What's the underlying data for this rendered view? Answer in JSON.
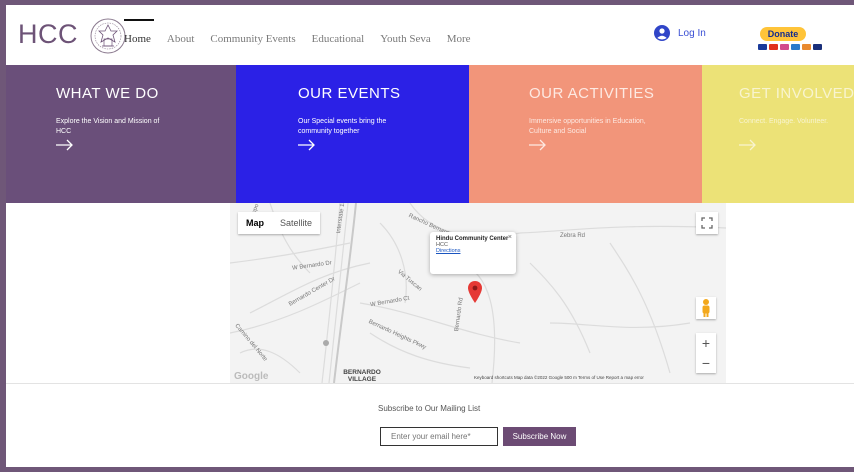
{
  "header": {
    "logo": "HCC",
    "nav": [
      "Home",
      "About",
      "Community Events",
      "Educational",
      "Youth Seva",
      "More"
    ],
    "login": "Log In",
    "donate": "Donate"
  },
  "panels": [
    {
      "title": "WHAT WE DO",
      "desc": "Explore the Vision and Mission of HCC",
      "color": "#6a4f7a"
    },
    {
      "title": "OUR EVENTS",
      "desc": "Our Special events bring the community together",
      "color": "#2b21e6"
    },
    {
      "title": "OUR ACTIVITIES",
      "desc": "Immersive opportunities in Education, Culture and Social",
      "color": "#f2957a"
    },
    {
      "title": "GET INVOLVED",
      "desc": "Connect. Engage. Volunteer.",
      "color": "#ece277"
    }
  ],
  "map": {
    "type_map": "Map",
    "type_satellite": "Satellite",
    "popup_name": "Hindu Community Center",
    "popup_sub": "HCC",
    "popup_link": "Directions",
    "labels": [
      "Interstate 15 Express",
      "Rancho Bernardo Rd",
      "W Bernardo Dr",
      "Bernardo Center Dr",
      "Camino del Norte",
      "Bernardo Heights Pkwy",
      "Bernardo Rd",
      "Zebra Rd",
      "Dos Campo",
      "W Bernardo Ct",
      "Via Tuscan"
    ],
    "village": "BERNARDO VILLAGE",
    "google": "Google",
    "attribution": "Keyboard shortcuts   Map data ©2022 Google   500 m   Terms of Use   Report a map error"
  },
  "subscribe": {
    "title": "Subscribe to Our Mailing List",
    "placeholder": "Enter your email here*",
    "button": "Subscribe Now"
  }
}
